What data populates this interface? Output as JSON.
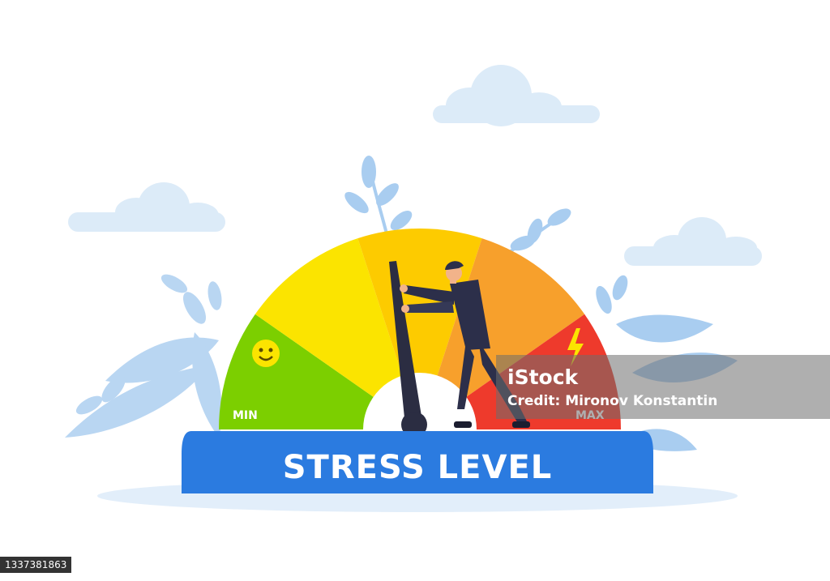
{
  "gauge": {
    "min_label": "MIN",
    "max_label": "MAX",
    "level_percent": 50,
    "zone_colors": [
      "#7ccf00",
      "#fbe400",
      "#fdcb00",
      "#f7a02c",
      "#ee3a2c"
    ],
    "needle_color": "#2b2d42",
    "min_icon": "smiley-face-icon",
    "max_icon": "lightning-bolt-icon"
  },
  "banner": {
    "title": "STRESS LEVEL",
    "color": "#2b7be0"
  },
  "watermark": {
    "brand": "iStock",
    "credit": "Credit: Mironov Konstantin"
  },
  "image_id": "1337381863",
  "colors": {
    "cloud": "#dcebf8",
    "leaf": "#a9cdf0",
    "suit": "#2c2f4a"
  }
}
